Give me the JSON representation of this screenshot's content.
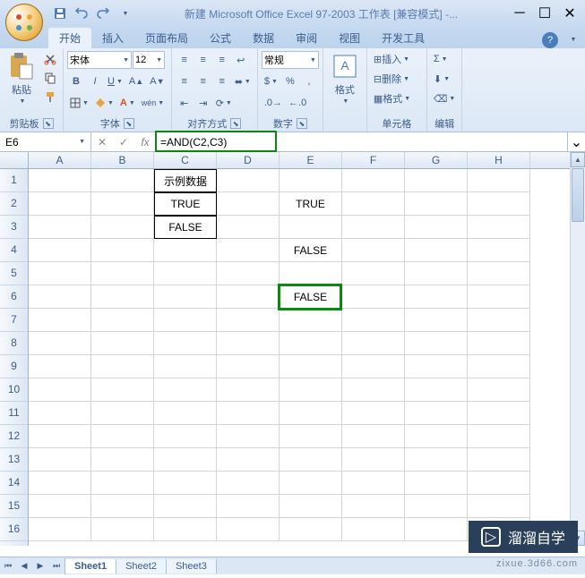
{
  "window": {
    "title": "新建 Microsoft Office Excel 97-2003 工作表 [兼容模式] -..."
  },
  "tabs": [
    "开始",
    "插入",
    "页面布局",
    "公式",
    "数据",
    "审阅",
    "视图",
    "开发工具"
  ],
  "active_tab": "开始",
  "ribbon": {
    "clipboard": {
      "paste": "粘贴",
      "label": "剪贴板"
    },
    "font": {
      "name": "宋体",
      "size": "12",
      "label": "字体"
    },
    "alignment": {
      "label": "对齐方式"
    },
    "number": {
      "format": "常规",
      "label": "数字"
    },
    "styles": {
      "format": "格式",
      "label": ""
    },
    "cells": {
      "insert": "插入",
      "delete": "删除",
      "format": "格式",
      "label": "单元格"
    },
    "editing": {
      "label": "编辑"
    }
  },
  "formulabar": {
    "namebox": "E6",
    "formula": "=AND(C2,C3)"
  },
  "columns": [
    "A",
    "B",
    "C",
    "D",
    "E",
    "F",
    "G",
    "H"
  ],
  "rows": [
    "1",
    "2",
    "3",
    "4",
    "5",
    "6",
    "7",
    "8",
    "9",
    "10",
    "11",
    "12",
    "13",
    "14",
    "15",
    "16"
  ],
  "cells": {
    "C1": "示例数据",
    "C2": "TRUE",
    "C3": "FALSE",
    "E2": "TRUE",
    "E4": "FALSE",
    "E6": "FALSE"
  },
  "sheets": [
    "Sheet1",
    "Sheet2",
    "Sheet3"
  ],
  "active_sheet": "Sheet1",
  "watermark": {
    "text": "溜溜自学",
    "sub": "zixue.3d66.com"
  }
}
